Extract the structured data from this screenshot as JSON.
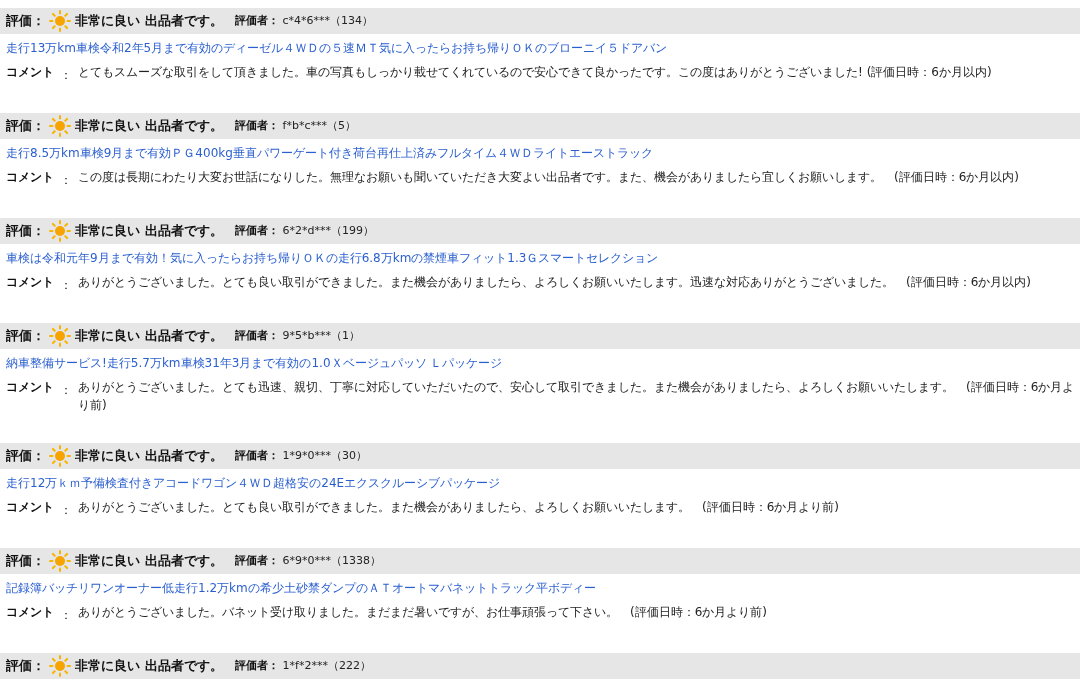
{
  "reviews": [
    {
      "rating_label": "評価：",
      "rating": "非常に良い 出品者です。",
      "rater_label": "評価者：",
      "rater": "c*4*6***（134）",
      "item": "走行13万km車検令和2年5月まで有効のディーゼル４ＷＤの５速ＭＴ気に入ったらお持ち帰りＯＫのブローニイ５ドアバン",
      "comment_label": "コメント",
      "comment_colon": "：",
      "comment": "とてもスムーズな取引をして頂きました。車の写真もしっかり載せてくれているので安心できて良かったです。この度はありがとうございました! (評価日時：6か月以内)"
    },
    {
      "rating_label": "評価：",
      "rating": "非常に良い 出品者です。",
      "rater_label": "評価者：",
      "rater": "f*b*c***（5）",
      "item": "走行8.5万km車検9月まで有効ＰＧ400kg垂直パワーゲート付き荷台再仕上済みフルタイム４ＷＤライトエーストラック",
      "comment_label": "コメント",
      "comment_colon": "：",
      "comment": "この度は長期にわたり大変お世話になりした。無理なお願いも聞いていただき大変よい出品者です。また、機会がありましたら宜しくお願いします。　(評価日時：6か月以内)"
    },
    {
      "rating_label": "評価：",
      "rating": "非常に良い 出品者です。",
      "rater_label": "評価者：",
      "rater": "6*2*d***（199）",
      "item": "車検は令和元年9月まで有効！気に入ったらお持ち帰りＯＫの走行6.8万kmの禁煙車フィット1.3Ｇスマートセレクション",
      "comment_label": "コメント",
      "comment_colon": "：",
      "comment": "ありがとうございました。とても良い取引ができました。また機会がありましたら、よろしくお願いいたします。迅速な対応ありがとうございました。　(評価日時：6か月以内)"
    },
    {
      "rating_label": "評価：",
      "rating": "非常に良い 出品者です。",
      "rater_label": "評価者：",
      "rater": "9*5*b***（1）",
      "item": "納車整備サービス!走行5.7万km車検31年3月まで有効の1.0Ｘベージュパッソ Ｌパッケージ",
      "comment_label": "コメント",
      "comment_colon": "：",
      "comment": "ありがとうございました。とても迅速、親切、丁寧に対応していただいたので、安心して取引できました。また機会がありましたら、よろしくお願いいたします。　(評価日時：6か月より前)"
    },
    {
      "rating_label": "評価：",
      "rating": "非常に良い 出品者です。",
      "rater_label": "評価者：",
      "rater": "1*9*0***（30）",
      "item": "走行12万ｋｍ予備検査付きアコードワゴン４ＷＤ超格安の24Eエクスクルーシブパッケージ",
      "comment_label": "コメント",
      "comment_colon": "：",
      "comment": "ありがとうございました。とても良い取引ができました。また機会がありましたら、よろしくお願いいたします。　(評価日時：6か月より前)"
    },
    {
      "rating_label": "評価：",
      "rating": "非常に良い 出品者です。",
      "rater_label": "評価者：",
      "rater": "6*9*0***（1338）",
      "item": "記録簿バッチリワンオーナー低走行1.2万kmの希少土砂禁ダンプのＡＴオートマバネットトラック平ボディー",
      "comment_label": "コメント",
      "comment_colon": "：",
      "comment": "ありがとうございました。バネット受け取りました。まだまだ暑いですが、お仕事頑張って下さい。　(評価日時：6か月より前)"
    },
    {
      "rating_label": "評価：",
      "rating": "非常に良い 出品者です。",
      "rater_label": "評価者：",
      "rater": "1*f*2***（222）"
    }
  ]
}
